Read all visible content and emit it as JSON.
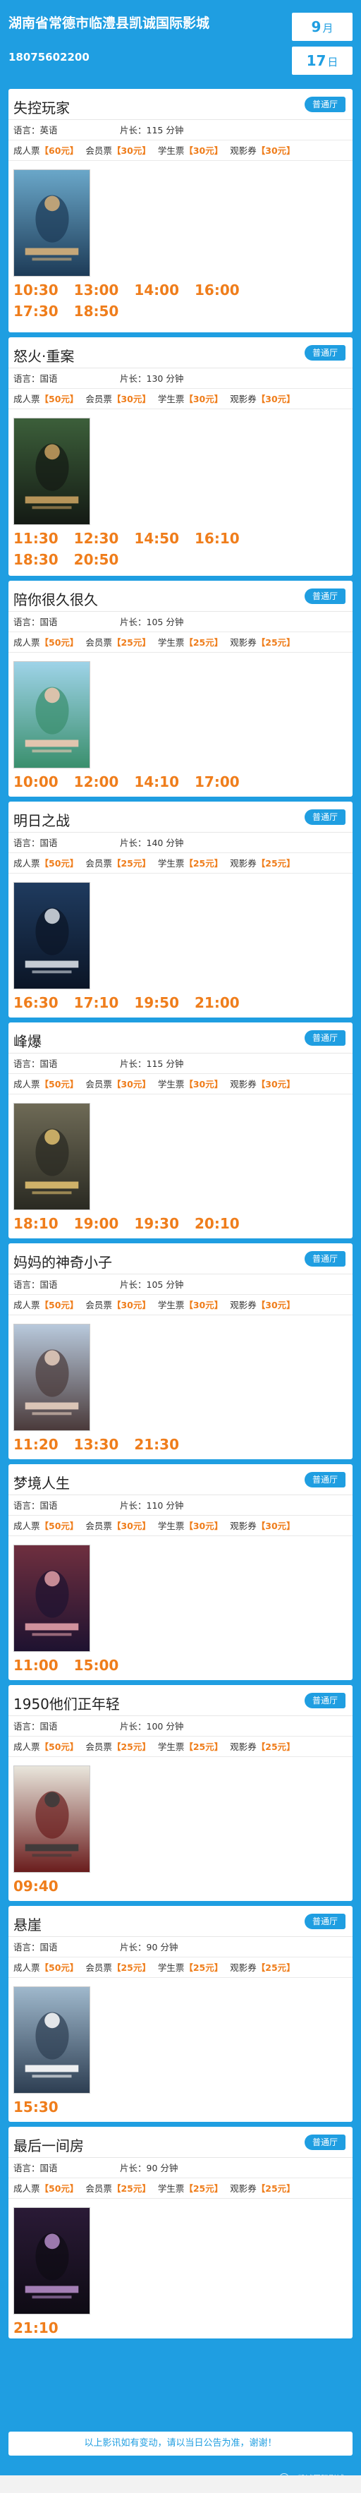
{
  "header": {
    "cinema_name": "湖南省常德市临澧县凯诚国际影城",
    "phone": "18075602200",
    "month": "9",
    "month_unit": "月",
    "day": "17",
    "day_unit": "日"
  },
  "labels": {
    "language": "语言：",
    "duration": "片长：",
    "minutes": "分钟",
    "adult": "成人票",
    "member": "会员票",
    "student": "学生票",
    "voucher": "观影券"
  },
  "movies": [
    {
      "title": "失控玩家",
      "hall": "普通厅",
      "language": "英语",
      "duration": "115",
      "adult": "【60元】",
      "member": "【30元】",
      "student": "【30元】",
      "voucher": "【30元】",
      "times": [
        [
          "10:30",
          "13:00",
          "14:00",
          "16:00"
        ],
        [
          "17:30",
          "18:50"
        ]
      ]
    },
    {
      "title": "怒火·重案",
      "hall": "普通厅",
      "language": "国语",
      "duration": "130",
      "adult": "【50元】",
      "member": "【30元】",
      "student": "【30元】",
      "voucher": "【30元】",
      "times": [
        [
          "11:30",
          "12:30",
          "14:50",
          "16:10"
        ],
        [
          "18:30",
          "20:50"
        ]
      ]
    },
    {
      "title": "陪你很久很久",
      "hall": "普通厅",
      "language": "国语",
      "duration": "105",
      "adult": "【50元】",
      "member": "【25元】",
      "student": "【25元】",
      "voucher": "【25元】",
      "times": [
        [
          "10:00",
          "12:00",
          "14:10",
          "17:00"
        ]
      ]
    },
    {
      "title": "明日之战",
      "hall": "普通厅",
      "language": "国语",
      "duration": "140",
      "adult": "【50元】",
      "member": "【25元】",
      "student": "【25元】",
      "voucher": "【25元】",
      "times": [
        [
          "16:30",
          "17:10",
          "19:50",
          "21:00"
        ]
      ]
    },
    {
      "title": "峰爆",
      "hall": "普通厅",
      "language": "国语",
      "duration": "115",
      "adult": "【50元】",
      "member": "【30元】",
      "student": "【30元】",
      "voucher": "【30元】",
      "times": [
        [
          "18:10",
          "19:00",
          "19:30",
          "20:10"
        ]
      ]
    },
    {
      "title": "妈妈的神奇小子",
      "hall": "普通厅",
      "language": "国语",
      "duration": "105",
      "adult": "【50元】",
      "member": "【30元】",
      "student": "【30元】",
      "voucher": "【30元】",
      "times": [
        [
          "11:20",
          "13:30",
          "21:30"
        ]
      ]
    },
    {
      "title": "梦境人生",
      "hall": "普通厅",
      "language": "国语",
      "duration": "110",
      "adult": "【50元】",
      "member": "【30元】",
      "student": "【30元】",
      "voucher": "【30元】",
      "times": [
        [
          "11:00",
          "15:00"
        ]
      ]
    },
    {
      "title": "1950他们正年轻",
      "hall": "普通厅",
      "language": "国语",
      "duration": "100",
      "adult": "【50元】",
      "member": "【25元】",
      "student": "【25元】",
      "voucher": "【25元】",
      "times": [
        [
          "09:40"
        ]
      ]
    },
    {
      "title": "悬崖",
      "hall": "普通厅",
      "language": "国语",
      "duration": "90",
      "adult": "【50元】",
      "member": "【25元】",
      "student": "【25元】",
      "voucher": "【25元】",
      "times": [
        [
          "15:30"
        ]
      ]
    },
    {
      "title": "最后一间房",
      "hall": "普通厅",
      "language": "国语",
      "duration": "90",
      "adult": "【50元】",
      "member": "【25元】",
      "student": "【25元】",
      "voucher": "【25元】",
      "times": [
        [
          "21:10"
        ]
      ]
    }
  ],
  "footer": {
    "notice": "以上影讯如有变动，请以当日公告为准，谢谢！",
    "watermark": "A凯诚国际影城"
  },
  "colors": {
    "brand_blue": "#1f9ee1",
    "time_orange": "#ef7d1b"
  }
}
